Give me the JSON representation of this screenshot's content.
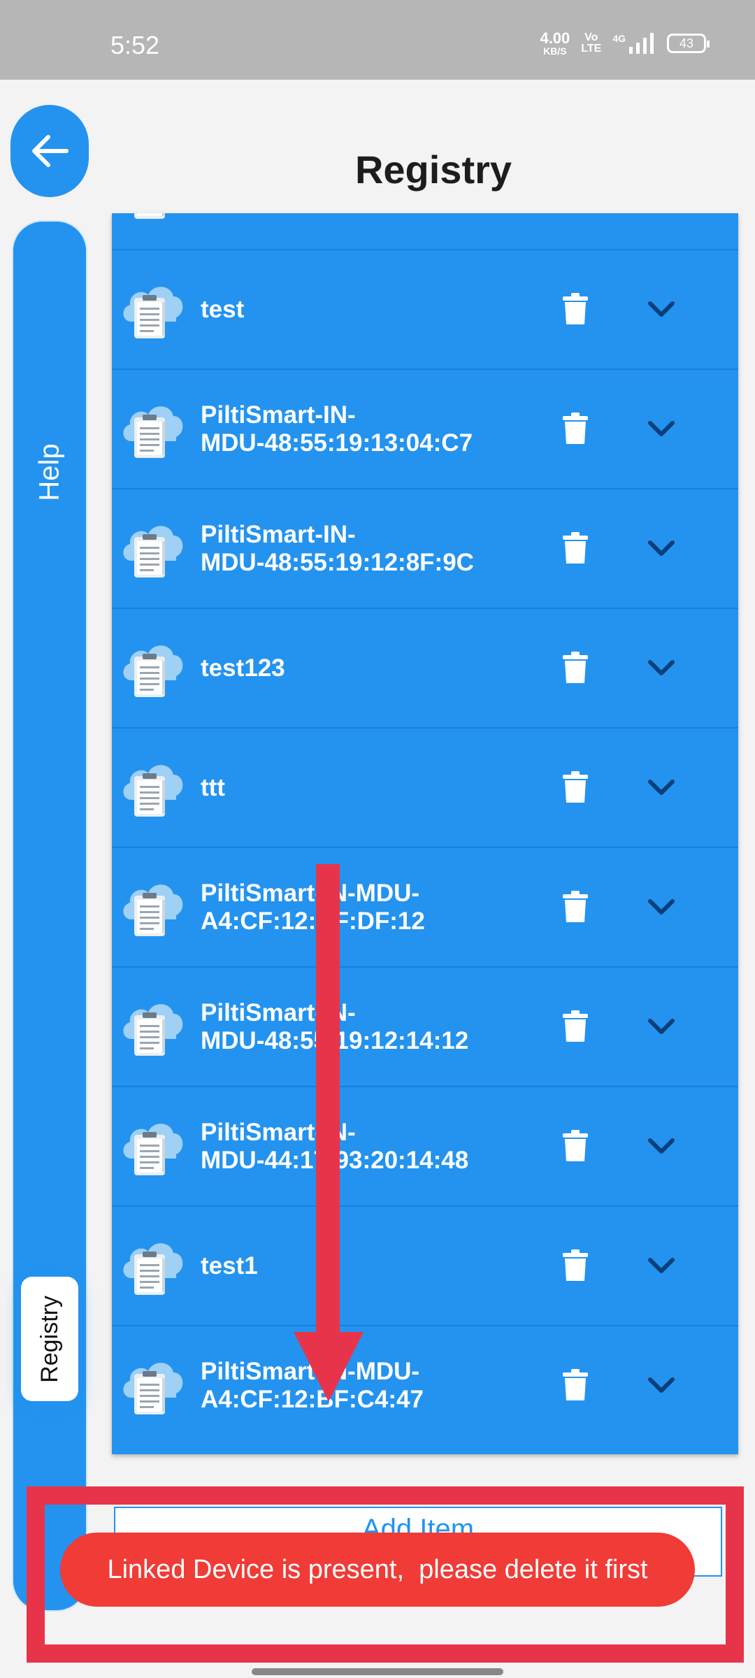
{
  "status_bar": {
    "time": "5:52",
    "net_speed_value": "4.00",
    "net_speed_unit": "KB/S",
    "volte_top": "Vo",
    "volte_bottom": "LTE",
    "network": "4G",
    "battery": "43"
  },
  "header": {
    "title": "Registry",
    "back_icon": "arrow-left-icon"
  },
  "side_tabs": {
    "help": "Help",
    "registry": "Registry"
  },
  "devices": [
    {
      "label": ""
    },
    {
      "label": "test"
    },
    {
      "label": "PiltiSmart-IN-\nMDU-48:55:19:13:04:C7"
    },
    {
      "label": "PiltiSmart-IN-\nMDU-48:55:19:12:8F:9C"
    },
    {
      "label": "test123"
    },
    {
      "label": "ttt"
    },
    {
      "label": "PiltiSmart-IN-MDU-\nA4:CF:12:BF:DF:12"
    },
    {
      "label": "PiltiSmart-IN-\nMDU-48:55:19:12:14:12"
    },
    {
      "label": "PiltiSmart-IN-\nMDU-44:17:93:20:14:48"
    },
    {
      "label": "test1"
    },
    {
      "label": "PiltiSmart-IN-MDU-\nA4:CF:12:BF:C4:47"
    }
  ],
  "row_icons": {
    "device": "cloud-clipboard-icon",
    "delete": "trash-icon",
    "expand": "chevron-down-icon"
  },
  "add_item_label": "Add Item",
  "toast": "Linked Device is present,  please delete it first",
  "colors": {
    "primary": "#2393ef",
    "row_divider": "#1a7fd6",
    "toast": "#f03b36",
    "annotation": "#e8344a",
    "status_bar": "#b6b6b6"
  }
}
